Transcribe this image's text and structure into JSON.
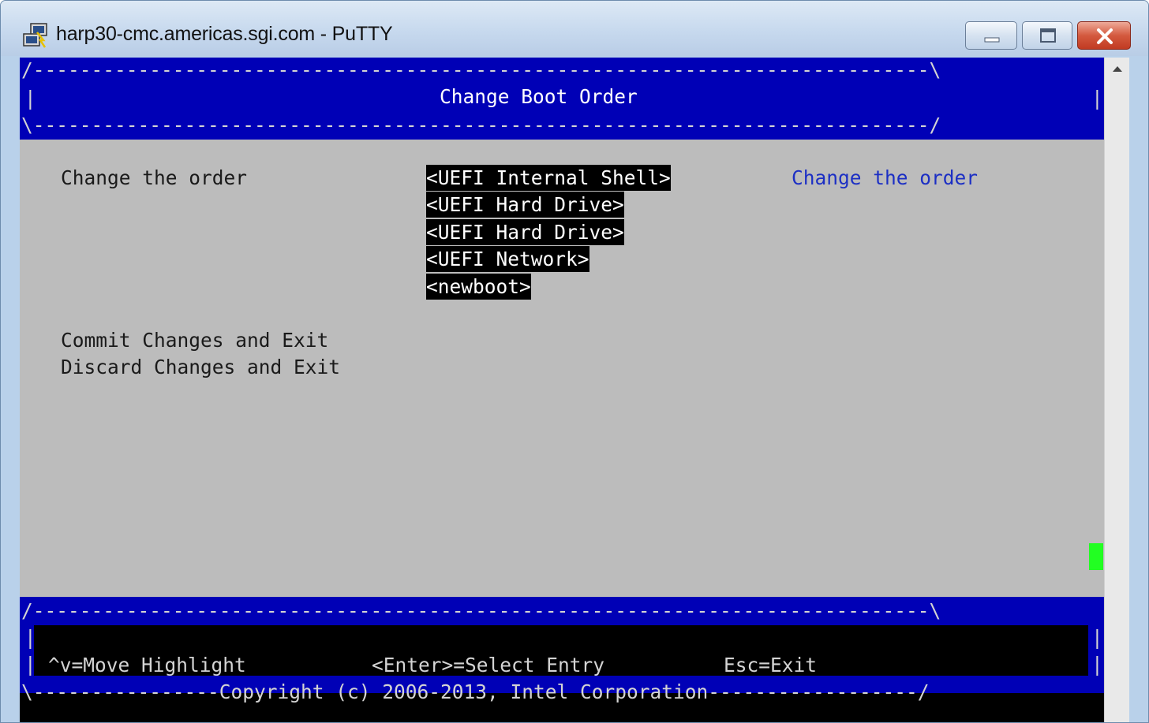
{
  "window": {
    "title": "harp30-cmc.americas.sgi.com - PuTTY",
    "icon": "putty-icon"
  },
  "terminal": {
    "header_border_top": "/-----------------------------------------------------------------------------\\",
    "header_border_bottom": "\\-----------------------------------------------------------------------------/",
    "header_side": "|",
    "title": "Change Boot Order",
    "option_label": "Change the order",
    "boot_entries": [
      "<UEFI Internal Shell>",
      "<UEFI Hard Drive>",
      "<UEFI Hard Drive>",
      "<UEFI Network>",
      "<newboot>"
    ],
    "help_text": "Change the order",
    "actions": {
      "commit": "Commit Changes and Exit",
      "discard": "Discard Changes and Exit"
    },
    "footer_border_top": "/-----------------------------------------------------------------------------\\",
    "footer_side": "|",
    "keys": {
      "move": "^v=Move Highlight",
      "select": "<Enter>=Select Entry",
      "exit": "Esc=Exit"
    },
    "copyright_line": "\\----------------Copyright (c) 2006-2013, Intel Corporation------------------/"
  },
  "colors": {
    "terminal_background": "#bcbcbc",
    "header_blue": "#0000b6",
    "help_text_blue": "#1c2fc4",
    "cursor_green": "#22ff22"
  }
}
